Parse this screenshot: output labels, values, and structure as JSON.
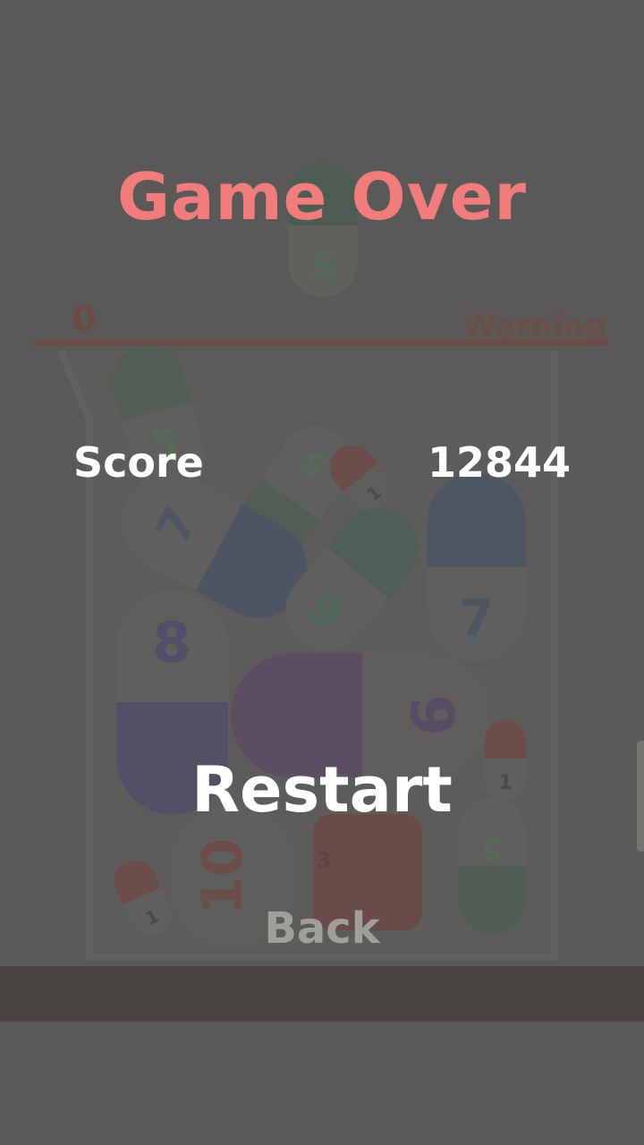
{
  "hud": {
    "score": "0",
    "warning": "Warning"
  },
  "game_over": {
    "title": "Game Over",
    "score_label": "Score",
    "score_value": "12844",
    "restart_label": "Restart",
    "back_label": "Back"
  },
  "pills": [
    {
      "number": "5"
    },
    {
      "number": "5"
    },
    {
      "number": "5"
    },
    {
      "number": "1"
    },
    {
      "number": "7"
    },
    {
      "number": "7"
    },
    {
      "number": "9"
    },
    {
      "number": "8"
    },
    {
      "number": "9"
    },
    {
      "number": "1"
    },
    {
      "number": "5"
    },
    {
      "number": "10"
    },
    {
      "number": "3"
    },
    {
      "number": "1"
    }
  ],
  "colors": {
    "background": "#5a5958",
    "title": "#f07d7b",
    "text": "#ffffff",
    "back_text": "#a19f9c"
  }
}
